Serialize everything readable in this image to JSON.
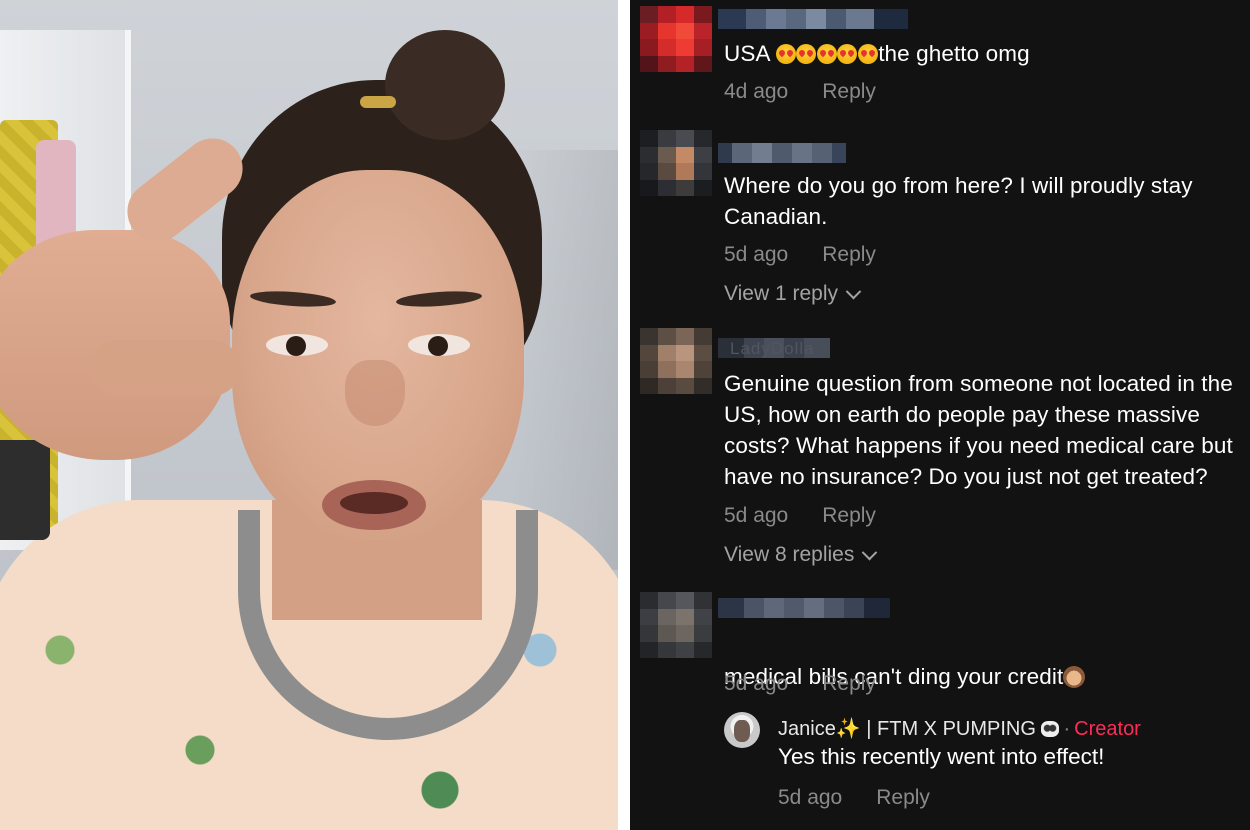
{
  "comments": [
    {
      "text_before_emoji": "USA ",
      "emoji_count": 5,
      "text_after_emoji": "the ghetto omg",
      "time": "4d ago",
      "reply_label": "Reply"
    },
    {
      "text": "Where do you go from here? I will proudly stay\nCanadian.",
      "time": "5d ago",
      "reply_label": "Reply",
      "view_replies": "View 1 reply"
    },
    {
      "username_fragment": "LadyDolla",
      "text": "Genuine question from someone not located in the\nUS, how on earth do people pay these massive\ncosts? What happens if you need medical care but\nhave no insurance? Do you just not get treated?",
      "time": "5d ago",
      "reply_label": "Reply",
      "view_replies": "View 8 replies"
    },
    {
      "text": "medical bills can't ding your credit",
      "emoji_icon": "see-no-evil-monkey-icon",
      "time": "5d ago",
      "reply_label": "Reply",
      "reply": {
        "author": "Janice",
        "author_suffix": " | FTM X PUMPING ",
        "separator": "·",
        "creator_label": "Creator",
        "text": "Yes this recently went into effect!",
        "time": "5d ago",
        "reply_label": "Reply"
      }
    }
  ],
  "colors": {
    "panel_background": "#121212",
    "text": "#ffffff",
    "meta": "#8a8a8a",
    "creator": "#fe2c55"
  }
}
